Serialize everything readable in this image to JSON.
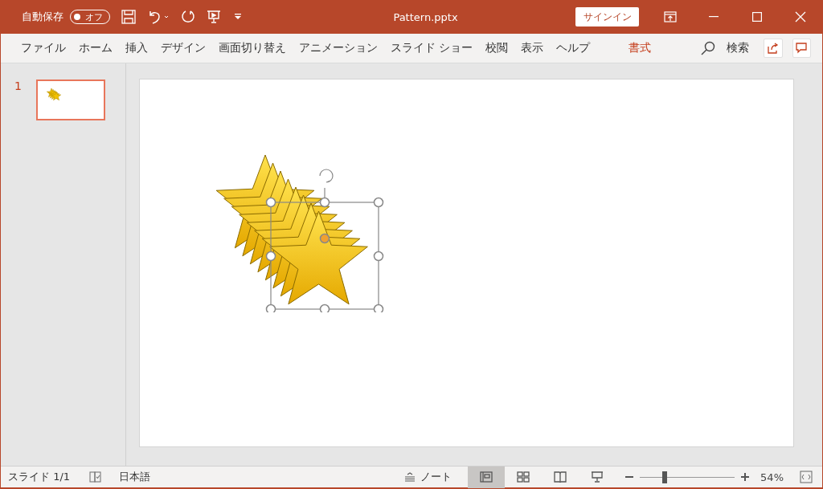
{
  "title_bar": {
    "autosave_label": "自動保存",
    "autosave": {
      "label": "オフ",
      "on": false
    },
    "title": "Pattern.pptx",
    "sign_in": "サインイン"
  },
  "ribbon_tabs": [
    {
      "label": "ファイル",
      "contextual": false
    },
    {
      "label": "ホーム",
      "contextual": false
    },
    {
      "label": "挿入",
      "contextual": false
    },
    {
      "label": "デザイン",
      "contextual": false
    },
    {
      "label": "画面切り替え",
      "contextual": false
    },
    {
      "label": "アニメーション",
      "contextual": false
    },
    {
      "label": "スライド ショー",
      "contextual": false
    },
    {
      "label": "校閲",
      "contextual": false
    },
    {
      "label": "表示",
      "contextual": false
    },
    {
      "label": "ヘルプ",
      "contextual": false
    },
    {
      "label": "書式",
      "contextual": true
    }
  ],
  "search": {
    "label": "検索"
  },
  "slides": [
    {
      "number": "1",
      "selected": true
    }
  ],
  "status_bar": {
    "slide": "スライド 1/1",
    "language": "日本語",
    "notes": "ノート",
    "views": [
      {
        "kind": "normal",
        "selected": true
      },
      {
        "kind": "sorter",
        "selected": false
      },
      {
        "kind": "reading",
        "selected": false
      },
      {
        "kind": "show",
        "selected": false
      }
    ],
    "zoom": {
      "level": 0.26,
      "reading": "54%"
    }
  }
}
